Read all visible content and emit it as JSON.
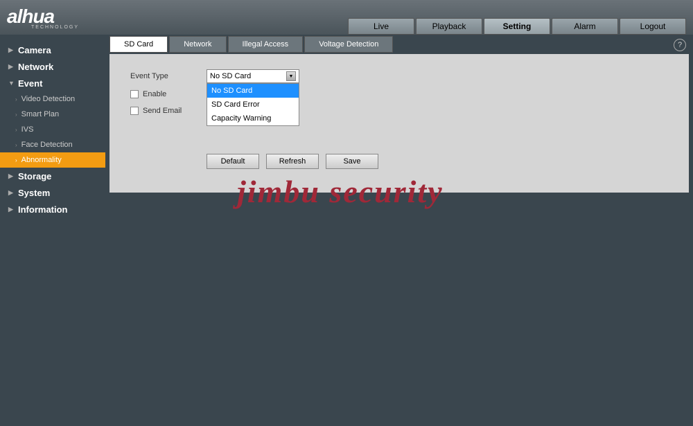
{
  "logo": {
    "brand": "alhua",
    "sub": "TECHNOLOGY"
  },
  "top_nav": {
    "live": "Live",
    "playback": "Playback",
    "setting": "Setting",
    "alarm": "Alarm",
    "logout": "Logout"
  },
  "sidebar": {
    "camera": "Camera",
    "network": "Network",
    "event": "Event",
    "event_subs": {
      "video_detection": "Video Detection",
      "smart_plan": "Smart Plan",
      "ivs": "IVS",
      "face_detection": "Face Detection",
      "abnormality": "Abnormality"
    },
    "storage": "Storage",
    "system": "System",
    "information": "Information"
  },
  "tabs": {
    "sd_card": "SD Card",
    "network": "Network",
    "illegal_access": "Illegal Access",
    "voltage_detection": "Voltage Detection"
  },
  "form": {
    "event_type_label": "Event Type",
    "enable_label": "Enable",
    "send_email_label": "Send Email",
    "dropdown_selected": "No SD Card",
    "dropdown_options": {
      "opt0": "No SD Card",
      "opt1": "SD Card Error",
      "opt2": "Capacity Warning"
    },
    "btn_default": "Default",
    "btn_refresh": "Refresh",
    "btn_save": "Save"
  },
  "help_icon": "?",
  "watermark": "jimbu security"
}
